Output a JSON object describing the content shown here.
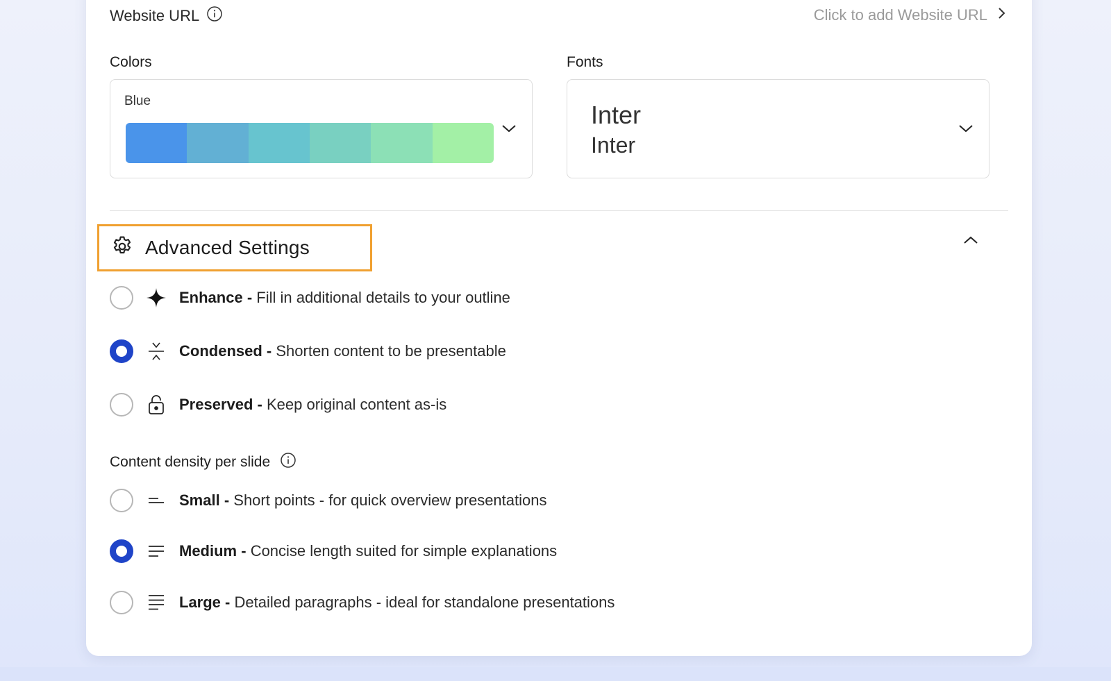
{
  "website_url": {
    "label": "Website URL",
    "action_text": "Click to add Website URL"
  },
  "colors": {
    "label": "Colors",
    "selected_palette": "Blue",
    "swatches": [
      "#4a94ea",
      "#62b0d4",
      "#67c4cf",
      "#79d0c1",
      "#8ce0b6",
      "#a3f0a6"
    ]
  },
  "fonts": {
    "label": "Fonts",
    "heading_font": "Inter",
    "body_font": "Inter"
  },
  "advanced": {
    "title": "Advanced Settings",
    "highlight_color": "#f0a030",
    "options": [
      {
        "name": "Enhance",
        "separator": " - ",
        "desc": "Fill in additional details to your outline",
        "icon": "sparkle-icon",
        "selected": false
      },
      {
        "name": "Condensed",
        "separator": " - ",
        "desc": "Shorten content to be presentable",
        "icon": "condense-icon",
        "selected": true
      },
      {
        "name": "Preserved",
        "separator": " - ",
        "desc": "Keep original content as-is",
        "icon": "lock-icon",
        "selected": false
      }
    ]
  },
  "density": {
    "label": "Content density per slide",
    "options": [
      {
        "name": "Small",
        "separator": " - ",
        "desc": "Short points - for quick overview presentations",
        "icon": "short-lines-icon",
        "selected": false
      },
      {
        "name": "Medium",
        "separator": " - ",
        "desc": "Concise length suited for simple explanations",
        "icon": "medium-lines-icon",
        "selected": true
      },
      {
        "name": "Large",
        "separator": " - ",
        "desc": "Detailed paragraphs - ideal for standalone presentations",
        "icon": "long-lines-icon",
        "selected": false
      }
    ]
  },
  "accent_color": "#1f44c8"
}
